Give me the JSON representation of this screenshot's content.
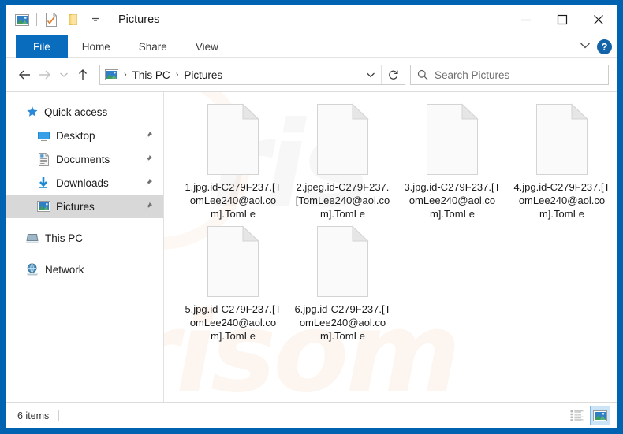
{
  "window": {
    "title": "Pictures",
    "frame_color": "#0063b1",
    "quick_access": [
      {
        "name": "pictures-folder-icon",
        "label": "Pictures"
      },
      {
        "name": "properties-icon",
        "label": "Properties"
      },
      {
        "name": "new-folder-icon",
        "label": "New folder"
      },
      {
        "name": "customize-quick-access-icon",
        "label": "Customize Quick Access Toolbar"
      }
    ],
    "controls": [
      {
        "name": "minimize-button",
        "glyph": "—"
      },
      {
        "name": "maximize-button",
        "glyph": "☐"
      },
      {
        "name": "close-button",
        "glyph": "✕"
      }
    ]
  },
  "ribbon": {
    "tabs": [
      {
        "label": "File",
        "selected": true
      },
      {
        "label": "Home",
        "selected": false
      },
      {
        "label": "Share",
        "selected": false
      },
      {
        "label": "View",
        "selected": false
      }
    ],
    "expand_label": "∨",
    "help_label": "?",
    "file_tab_color": "#0a6cbc"
  },
  "navigation": {
    "back_label": "←",
    "forward_label": "→",
    "recent_label": "∨",
    "up_label": "↑",
    "breadcrumbs": [
      "This PC",
      "Pictures"
    ],
    "separator": "›",
    "dropdown_label": "∨",
    "refresh_label": "↻"
  },
  "search": {
    "placeholder": "Search Pictures",
    "value": ""
  },
  "sidebar": {
    "groups": [
      {
        "label": "Quick access",
        "icon": "star-icon",
        "items": [
          {
            "label": "Desktop",
            "icon": "desktop-icon",
            "pinned": true,
            "selected": false
          },
          {
            "label": "Documents",
            "icon": "documents-icon",
            "pinned": true,
            "selected": false
          },
          {
            "label": "Downloads",
            "icon": "downloads-icon",
            "pinned": true,
            "selected": false
          },
          {
            "label": "Pictures",
            "icon": "pictures-icon",
            "pinned": true,
            "selected": true
          }
        ]
      },
      {
        "label": "This PC",
        "icon": "this-pc-icon",
        "items": []
      },
      {
        "label": "Network",
        "icon": "network-icon",
        "items": []
      }
    ]
  },
  "content": {
    "files": [
      {
        "name": "1.jpg.id-C279F237.[TomLee240@aol.com].TomLe",
        "icon": "generic-file-icon"
      },
      {
        "name": "2.jpeg.id-C279F237.[TomLee240@aol.com].TomLe",
        "icon": "generic-file-icon"
      },
      {
        "name": "3.jpg.id-C279F237.[TomLee240@aol.com].TomLe",
        "icon": "generic-file-icon"
      },
      {
        "name": "4.jpg.id-C279F237.[TomLee240@aol.com].TomLe",
        "icon": "generic-file-icon"
      },
      {
        "name": "5.jpg.id-C279F237.[TomLee240@aol.com].TomLe",
        "icon": "generic-file-icon"
      },
      {
        "name": "6.jpg.id-C279F237.[TomLee240@aol.com].TomLe",
        "icon": "generic-file-icon"
      }
    ],
    "watermark_grey": "ris",
    "watermark_orange": "risom"
  },
  "statusbar": {
    "item_count": "6 items",
    "views": [
      {
        "name": "details-view-button",
        "active": false
      },
      {
        "name": "large-icons-view-button",
        "active": true
      }
    ]
  }
}
